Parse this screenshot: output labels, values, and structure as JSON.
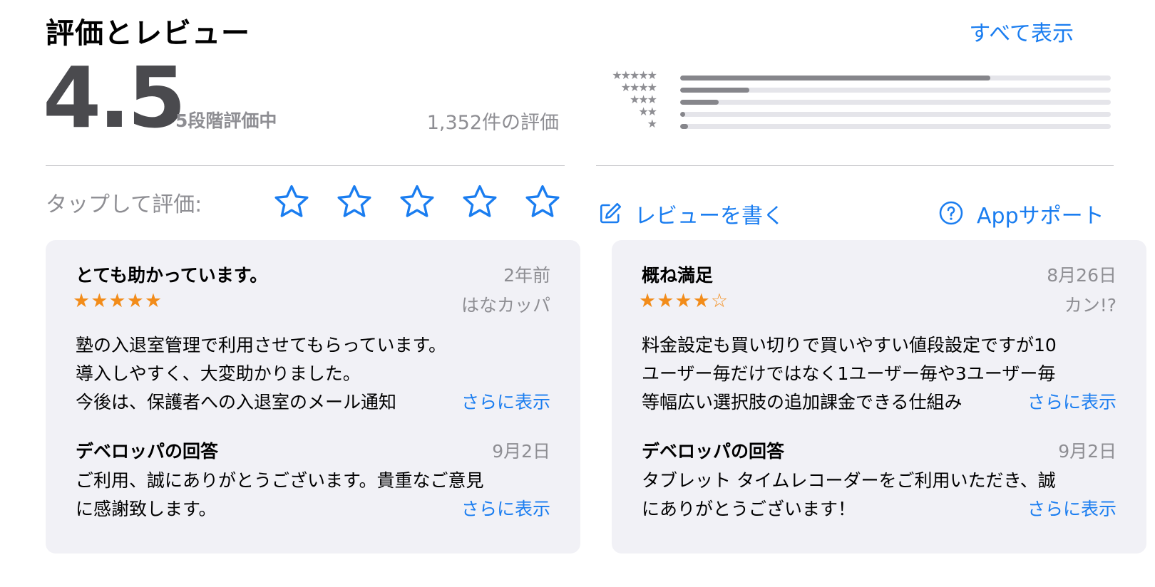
{
  "header": {
    "title": "評価とレビュー",
    "see_all": "すべて表示"
  },
  "summary": {
    "score": "4.5",
    "out_of": "5段階評価中",
    "count": "1,352件の評価",
    "histogram": [
      {
        "stars": "★★★★★",
        "fraction": 0.72
      },
      {
        "stars": "★★★★",
        "fraction": 0.16
      },
      {
        "stars": "★★★",
        "fraction": 0.09
      },
      {
        "stars": "★★",
        "fraction": 0.012
      },
      {
        "stars": "★",
        "fraction": 0.018
      }
    ]
  },
  "tap_to_rate": {
    "label": "タップして評価:",
    "stars": 5
  },
  "actions": {
    "write_review": "レビューを書く",
    "app_support": "Appサポート"
  },
  "colors": {
    "accent": "#1a7df0",
    "star_orange": "#f28c1a",
    "card_bg": "#f1f1f6",
    "muted": "#8e8e93"
  },
  "reviews": [
    {
      "title": "とても助かっています。",
      "date": "2年前",
      "rating_text": "★★★★★",
      "author": "はなカッパ",
      "lines": [
        "塾の入退室管理で利用させてもらっています。",
        "導入しやすく、大変助かりました。",
        "今後は、保護者への入退室のメール通知"
      ],
      "more": "さらに表示",
      "dev_title": "デベロッパの回答",
      "dev_date": "9月2日",
      "dev_lines": [
        "ご利用、誠にありがとうございます。貴重なご意見",
        "に感謝致します。"
      ],
      "dev_more": "さらに表示"
    },
    {
      "title": "概ね満足",
      "date": "8月26日",
      "rating_text": "★★★★☆",
      "author": "カン!?",
      "lines": [
        "料金設定も買い切りで買いやすい値段設定ですが10",
        "ユーザー毎だけではなく1ユーザー毎や3ユーザー毎",
        "等幅広い選択肢の追加課金できる仕組み"
      ],
      "more": "さらに表示",
      "dev_title": "デベロッパの回答",
      "dev_date": "9月2日",
      "dev_lines": [
        "タブレット タイムレコーダーをご利用いただき、誠",
        "にありがとうございます！"
      ],
      "dev_more": "さらに表示"
    }
  ]
}
